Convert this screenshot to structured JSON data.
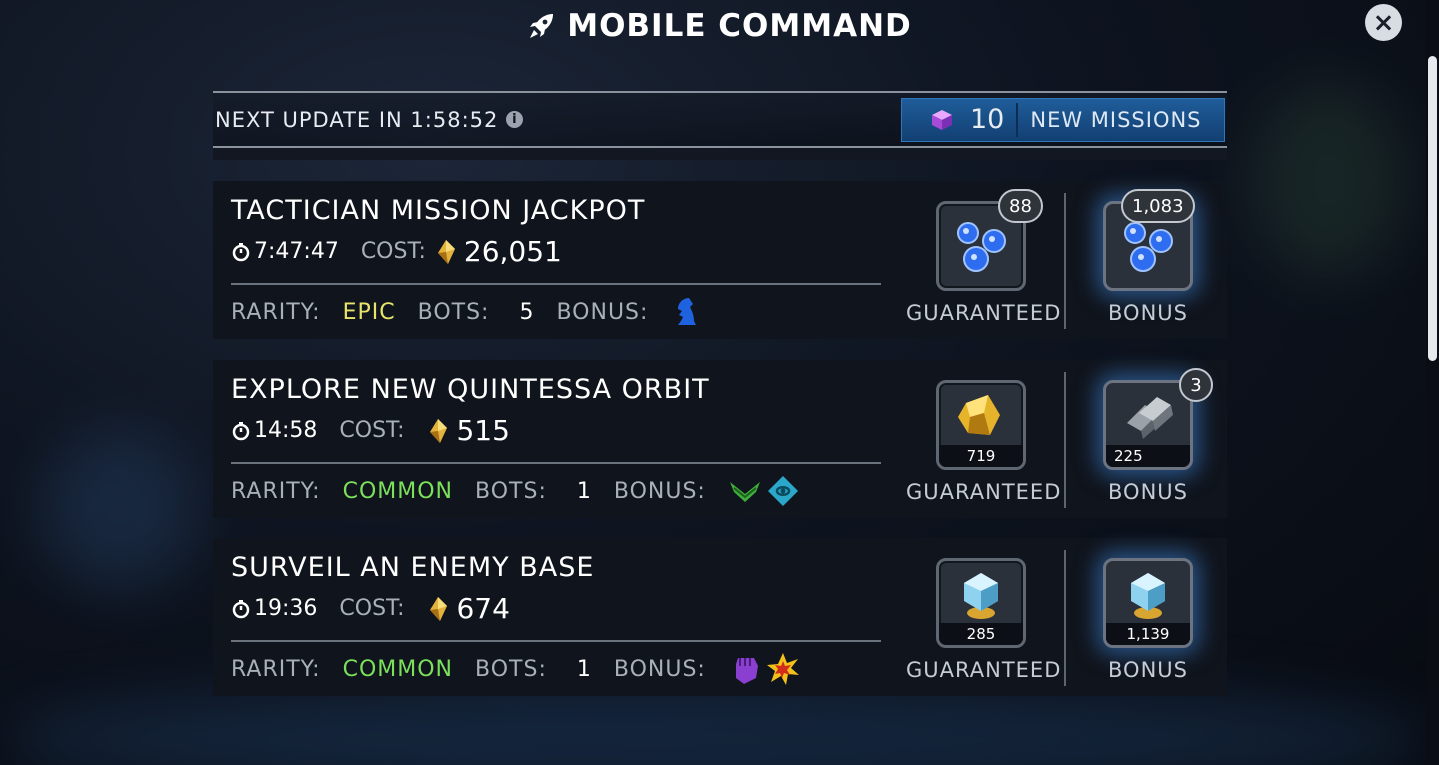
{
  "header": {
    "title": "MOBILE COMMAND"
  },
  "update_bar": {
    "label": "NEXT UPDATE IN 1:58:52",
    "info_glyph": "i",
    "new_missions": {
      "count": "10",
      "label": "NEW MISSIONS"
    }
  },
  "close": {
    "glyph": "×"
  },
  "colors": {
    "accent_blue": "#1f5d9a",
    "epic": "#e7e36b",
    "common": "#7be05a"
  },
  "missions": [
    {
      "title": "TACTICIAN MISSION JACKPOT",
      "time": "7:47:47",
      "cost_label": "COST:",
      "cost": "26,051",
      "rarity_label": "RARITY:",
      "rarity": "EPIC",
      "bots_label": "BOTS:",
      "bots": "5",
      "bonus_label": "BONUS:",
      "bonus_icons": [
        "knight-icon"
      ],
      "guaranteed": {
        "label": "GUARANTEED",
        "badge": "88",
        "count": "",
        "icon": "blue-orbs-icon"
      },
      "bonus": {
        "label": "BONUS",
        "badge": "1,083",
        "count": "",
        "icon": "blue-orbs-icon"
      }
    },
    {
      "title": "EXPLORE NEW QUINTESSA ORBIT",
      "time": "14:58",
      "cost_label": "COST:",
      "cost": "515",
      "rarity_label": "RARITY:",
      "rarity": "COMMON",
      "bots_label": "BOTS:",
      "bots": "1",
      "bonus_label": "BONUS:",
      "bonus_icons": [
        "wings-icon",
        "diamond-symbol-icon"
      ],
      "guaranteed": {
        "label": "GUARANTEED",
        "badge": "",
        "count": "719",
        "icon": "gold-ore-icon"
      },
      "bonus": {
        "label": "BONUS",
        "badge": "3",
        "count": "225",
        "icon": "metal-ingots-icon"
      }
    },
    {
      "title": "SURVEIL AN ENEMY BASE",
      "time": "19:36",
      "cost_label": "COST:",
      "cost": "674",
      "rarity_label": "RARITY:",
      "rarity": "COMMON",
      "bots_label": "BOTS:",
      "bots": "1",
      "bonus_label": "BONUS:",
      "bonus_icons": [
        "fist-icon",
        "explosion-icon"
      ],
      "guaranteed": {
        "label": "GUARANTEED",
        "badge": "",
        "count": "285",
        "icon": "crystal-icon"
      },
      "bonus": {
        "label": "BONUS",
        "badge": "",
        "count": "1,139",
        "icon": "crystal-icon"
      }
    }
  ]
}
